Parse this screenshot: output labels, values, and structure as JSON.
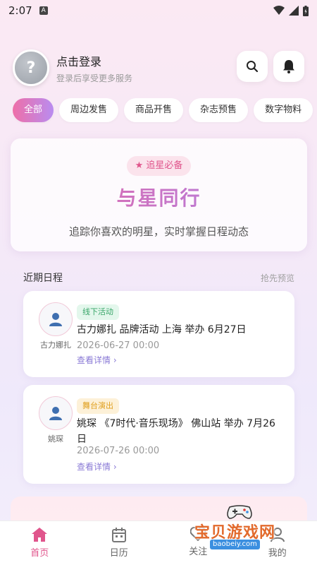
{
  "status_bar": {
    "time": "2:07",
    "indicator": "A"
  },
  "user": {
    "avatar_glyph": "?",
    "login_title": "点击登录",
    "login_sub": "登录后享受更多服务"
  },
  "header_icons": [
    "search-icon",
    "bell-icon"
  ],
  "categories": [
    {
      "label": "全部",
      "active": true
    },
    {
      "label": "周边发售"
    },
    {
      "label": "商品开售"
    },
    {
      "label": "杂志预售"
    },
    {
      "label": "数字物料"
    }
  ],
  "hero": {
    "badge": "★ 追星必备",
    "title": "与星同行",
    "subtitle": "追踪你喜欢的明星，实时掌握日程动态"
  },
  "schedule": {
    "title": "近期日程",
    "more": "抢先预览",
    "items": [
      {
        "name": "古力娜扎",
        "tag": "线下活动",
        "title": "古力娜扎 品牌活动 上海 举办 6月27日",
        "date": "2026-06-27 00:00",
        "link": "查看详情 ›"
      },
      {
        "name": "姚琛",
        "tag": "舞台演出",
        "title": "姚琛 《7时代·音乐现场》 佛山站 举办 7月26日",
        "date": "2026-07-26 00:00",
        "link": "查看详情 ›"
      }
    ]
  },
  "tabbar": {
    "items": [
      {
        "label": "首页",
        "icon": "home-icon",
        "active": true
      },
      {
        "label": "日历",
        "icon": "calendar-icon"
      },
      {
        "label": "关注",
        "icon": "heart-icon"
      },
      {
        "label": "我的",
        "icon": "user-icon"
      }
    ]
  },
  "watermark": {
    "text": "宝贝游戏网",
    "url": "baobeiy.com"
  },
  "colors": {
    "accent_pink": "#e0558c",
    "accent_purple": "#a97fe6",
    "link": "#8a7ad6"
  }
}
